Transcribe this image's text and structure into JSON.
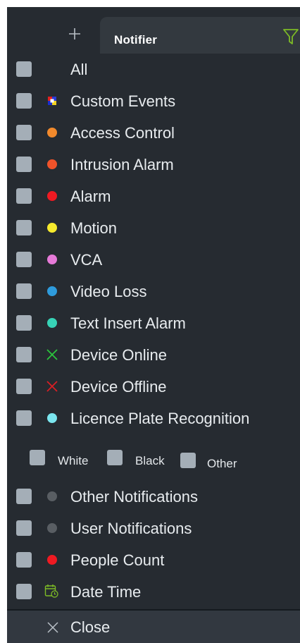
{
  "header": {
    "plus_icon": "plus-icon",
    "tab_label": "Notifier",
    "filter_icon": "filter-icon",
    "filter_color": "#7dbb26"
  },
  "items": [
    {
      "label": "All",
      "icon": "none"
    },
    {
      "label": "Custom Events",
      "icon": "custom-events-icon"
    },
    {
      "label": "Access Control",
      "icon": "dot",
      "color": "#f28a2c"
    },
    {
      "label": "Intrusion Alarm",
      "icon": "dot",
      "color": "#f0532a"
    },
    {
      "label": "Alarm",
      "icon": "dot",
      "color": "#ef1a22"
    },
    {
      "label": "Motion",
      "icon": "dot",
      "color": "#f6ea2d"
    },
    {
      "label": "VCA",
      "icon": "dot",
      "color": "#e67ad8"
    },
    {
      "label": "Video Loss",
      "icon": "dot",
      "color": "#2e9bdc"
    },
    {
      "label": "Text Insert Alarm",
      "icon": "dot",
      "color": "#37d3b6"
    },
    {
      "label": "Device Online",
      "icon": "x-icon",
      "color": "#2bc43d"
    },
    {
      "label": "Device Offline",
      "icon": "x-icon",
      "color": "#d81f25"
    },
    {
      "label": "Licence Plate Recognition",
      "icon": "dot",
      "color": "#7be6ef"
    },
    {
      "label": "Other Notifications",
      "icon": "dot",
      "color": "#595e63"
    },
    {
      "label": "User Notifications",
      "icon": "dot",
      "color": "#595e63"
    },
    {
      "label": "People Count",
      "icon": "dot",
      "color": "#ef1a22"
    },
    {
      "label": "Date Time",
      "icon": "calendar-clock-icon",
      "color": "#7dbb26"
    }
  ],
  "plate_colors": [
    {
      "label": "White"
    },
    {
      "label": "Black"
    },
    {
      "label": "Other"
    }
  ],
  "footer": {
    "close_label": "Close",
    "close_icon": "close-icon"
  }
}
